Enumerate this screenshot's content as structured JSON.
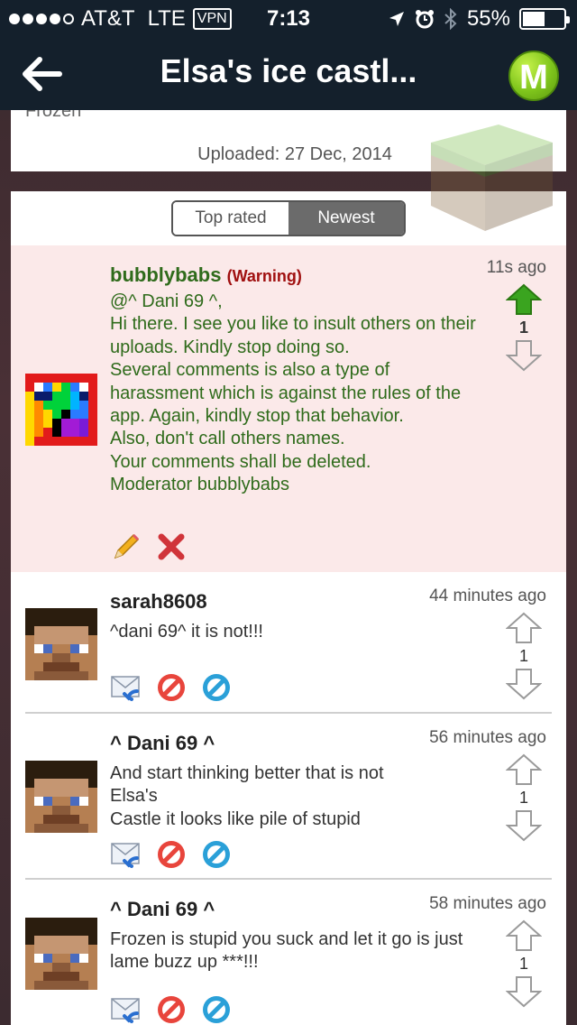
{
  "status": {
    "carrier": "AT&T",
    "network": "LTE",
    "vpn": "VPN",
    "time": "7:13",
    "battery": "55%",
    "battery_level": 0.55,
    "signal_bars": 4
  },
  "navbar": {
    "title": "Elsa's ice castl...",
    "logo_letter": "M"
  },
  "upload": {
    "cut_text": "Frozen",
    "uploaded": "Uploaded: 27 Dec, 2014"
  },
  "tabs": {
    "top_rated": "Top rated",
    "newest": "Newest",
    "active": "Newest"
  },
  "comments": [
    {
      "username": "bubblybabs",
      "warning": "(Warning)",
      "time": "11s ago",
      "votes": "1",
      "upvoted": true,
      "text": "@^ Dani 69 ^,\nHi there. I see you like to insult others on their uploads. Kindly stop doing so.\nSeveral comments is also a type of harassment which is against the rules of the app. Again, kindly stop that behavior.\nAlso, don't call others names.\nYour comments shall be deleted.\nModerator bubblybabs"
    },
    {
      "username": "sarah8608",
      "time": "44 minutes ago",
      "votes": "1",
      "text": "^dani 69^ it is not!!!"
    },
    {
      "username": "^ Dani 69 ^",
      "time": "56 minutes ago",
      "votes": "1",
      "text": "And start thinking better that is not Elsa's\nCastle it looks like pile of stupid"
    },
    {
      "username": "^ Dani 69 ^",
      "time": "58 minutes ago",
      "votes": "1",
      "text": "Frozen is stupid you suck and let it go is just lame buzz up ***!!!"
    }
  ],
  "colors": {
    "bar": "#14202c",
    "upvote_active": "#3aa41f",
    "moderator_text": "#2f6b1b",
    "warning": "#a01010"
  }
}
